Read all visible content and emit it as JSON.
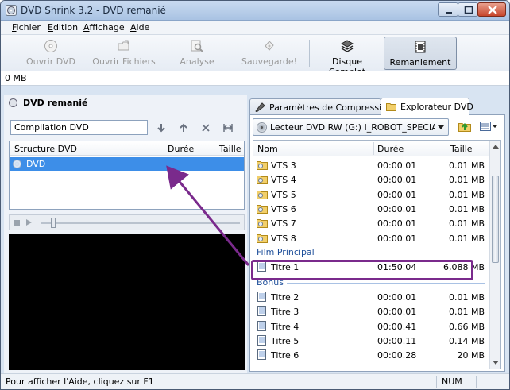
{
  "window": {
    "title": "DVD Shrink 3.2 - DVD remanié"
  },
  "menu": [
    "Fichier",
    "Edition",
    "Affichage",
    "Aide"
  ],
  "toolbar": {
    "open_dvd": "Ouvrir DVD",
    "open_files": "Ouvrir Fichiers",
    "analyze": "Analyse",
    "backup": "Sauvegarde!",
    "full_disc": "Disque Complet",
    "reauthor": "Remaniement"
  },
  "size_readout": "0 MB",
  "left": {
    "title": "DVD remanié",
    "compilation_value": "Compilation DVD",
    "columns": {
      "structure": "Structure DVD",
      "duration": "Durée",
      "size": "Taille"
    },
    "item": "DVD"
  },
  "tabs": {
    "compression": "Paramètres de Compression",
    "explorer": "Explorateur DVD"
  },
  "explorer": {
    "drive": "Lecteur DVD RW (G:) I_ROBOT_SPECIAL_EDI",
    "columns": {
      "name": "Nom",
      "duration": "Durée",
      "size": "Taille"
    },
    "vts": [
      {
        "name": "VTS 3",
        "duration": "00:00.01",
        "size": "0.01 MB"
      },
      {
        "name": "VTS 4",
        "duration": "00:00.01",
        "size": "0.01 MB"
      },
      {
        "name": "VTS 5",
        "duration": "00:00.01",
        "size": "0.01 MB"
      },
      {
        "name": "VTS 6",
        "duration": "00:00.01",
        "size": "0.01 MB"
      },
      {
        "name": "VTS 7",
        "duration": "00:00.01",
        "size": "0.01 MB"
      },
      {
        "name": "VTS 8",
        "duration": "00:00.01",
        "size": "0.01 MB"
      }
    ],
    "film_group": "Film Principal",
    "film": {
      "name": "Titre 1",
      "duration": "01:50.04",
      "size": "6,088 MB"
    },
    "bonus_group": "Bonus",
    "bonus": [
      {
        "name": "Titre 2",
        "duration": "00:00.01",
        "size": "0.01 MB"
      },
      {
        "name": "Titre 3",
        "duration": "00:00.01",
        "size": "0.01 MB"
      },
      {
        "name": "Titre 4",
        "duration": "00:00.41",
        "size": "0.66 MB"
      },
      {
        "name": "Titre 5",
        "duration": "00:00.11",
        "size": "0.14 MB"
      },
      {
        "name": "Titre 6",
        "duration": "00:00.28",
        "size": "20 MB"
      }
    ]
  },
  "status": {
    "message": "Pour afficher l'Aide, cliquez sur F1",
    "num": "NUM"
  },
  "colors": {
    "selection": "#3d8ee8",
    "annotation": "#7a2a8c"
  }
}
